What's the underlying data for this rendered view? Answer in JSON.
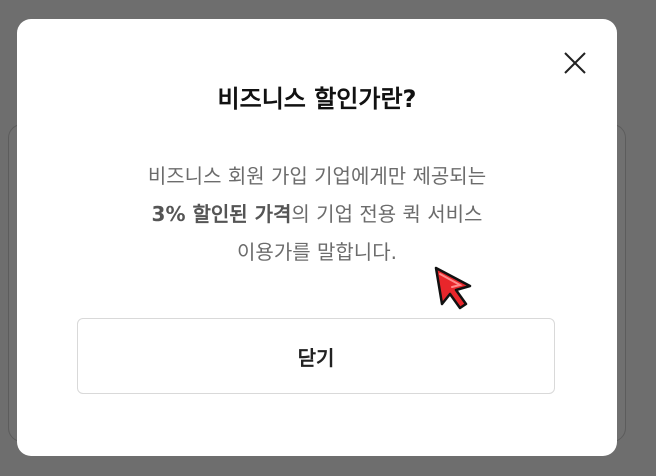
{
  "modal": {
    "title": "비즈니스 할인가란?",
    "description": {
      "line1": "비즈니스 회원 가입 기업에게만 제공되는",
      "line2_bold": "3% 할인된 가격",
      "line2_rest": "의 기업 전용 퀵 서비스",
      "line3": "이용가를 말합니다."
    },
    "close_button_label": "닫기",
    "close_icon": "close-icon"
  },
  "colors": {
    "backdrop": "#6e6e6e",
    "modal_bg": "#ffffff",
    "cursor_fill": "#e8262b"
  }
}
